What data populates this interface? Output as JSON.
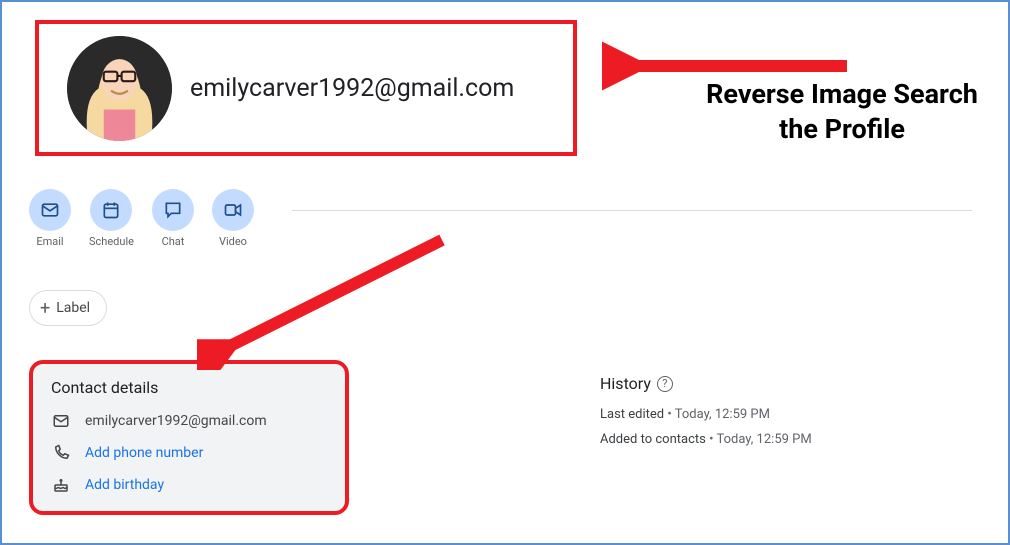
{
  "header": {
    "email": "emilycarver1992@gmail.com"
  },
  "actions": {
    "email_label": "Email",
    "schedule_label": "Schedule",
    "chat_label": "Chat",
    "video_label": "Video"
  },
  "label_button": {
    "text": "Label"
  },
  "contact_details": {
    "title": "Contact details",
    "email": "emilycarver1992@gmail.com",
    "add_phone": "Add phone number",
    "add_birthday": "Add birthday"
  },
  "history": {
    "title": "History",
    "last_edited_label": "Last edited",
    "last_edited_value": "Today, 12:59 PM",
    "added_label": "Added to contacts",
    "added_value": "Today, 12:59 PM"
  },
  "annotation": {
    "reverse_image": "Reverse Image Search the Profile"
  }
}
